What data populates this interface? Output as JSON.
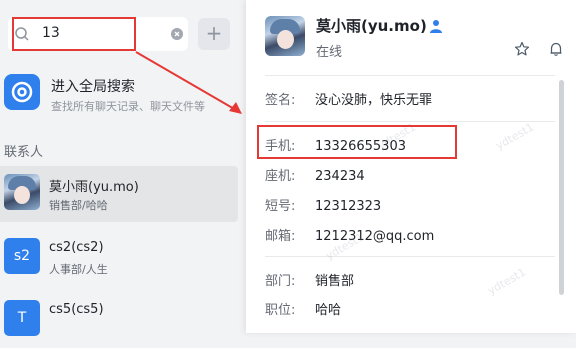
{
  "search": {
    "value": "13"
  },
  "global_search": {
    "title": "进入全局搜索",
    "subtitle": "查找所有聊天记录、聊天文件等"
  },
  "contacts_section": "联系人",
  "contacts": [
    {
      "name": "莫小雨(yu.mo)",
      "dept": "销售部/哈哈",
      "avatar_text": ""
    },
    {
      "name": "cs2(cs2)",
      "dept": "人事部/人生",
      "avatar_text": "s2"
    },
    {
      "name": "cs5(cs5)",
      "dept": "",
      "avatar_text": "T"
    }
  ],
  "profile": {
    "name": "莫小雨(yu.mo)",
    "status": "在线",
    "fields": [
      {
        "label": "签名:",
        "value": "没心没肺，快乐无罪"
      },
      {
        "label": "手机:",
        "value": "13326655303"
      },
      {
        "label": "座机:",
        "value": "234234"
      },
      {
        "label": "短号:",
        "value": "12312323"
      },
      {
        "label": "邮箱:",
        "value": "1212312@qq.com"
      },
      {
        "label": "部门:",
        "value": "销售部"
      },
      {
        "label": "职位:",
        "value": "哈哈"
      }
    ]
  },
  "watermark": "ydtest1",
  "colors": {
    "accent": "#2f80ed",
    "highlight": "#e53935"
  },
  "icons": {
    "search": "search-icon",
    "clear": "clear-icon",
    "add": "plus-icon",
    "global": "at-sign-icon",
    "person": "person-icon",
    "star": "star-icon",
    "bell": "bell-icon"
  }
}
